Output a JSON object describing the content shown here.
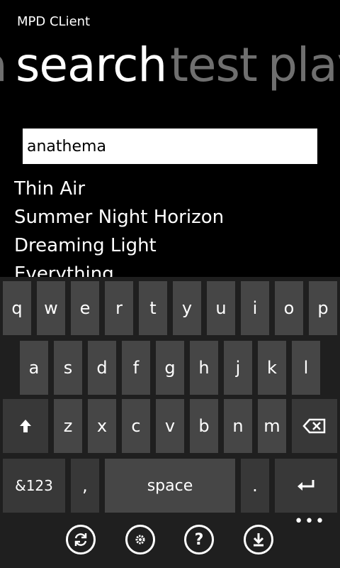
{
  "app": {
    "title": "MPD CLient"
  },
  "pivot": {
    "prev": "a",
    "active": "search",
    "next1": "test",
    "next2": "play"
  },
  "search": {
    "value": "anathema"
  },
  "results": [
    "Thin Air",
    "Summer Night Horizon",
    "Dreaming Light",
    "Everything"
  ],
  "keyboard": {
    "row1": [
      "q",
      "w",
      "e",
      "r",
      "t",
      "y",
      "u",
      "i",
      "o",
      "p"
    ],
    "row2": [
      "a",
      "s",
      "d",
      "f",
      "g",
      "h",
      "j",
      "k",
      "l"
    ],
    "row3": [
      "z",
      "x",
      "c",
      "v",
      "b",
      "n",
      "m"
    ],
    "symbols_label": "&123",
    "comma_label": ",",
    "space_label": "space",
    "period_label": "."
  },
  "appbar": {
    "buttons": [
      "refresh-icon",
      "settings-icon",
      "help-icon",
      "download-icon"
    ]
  }
}
